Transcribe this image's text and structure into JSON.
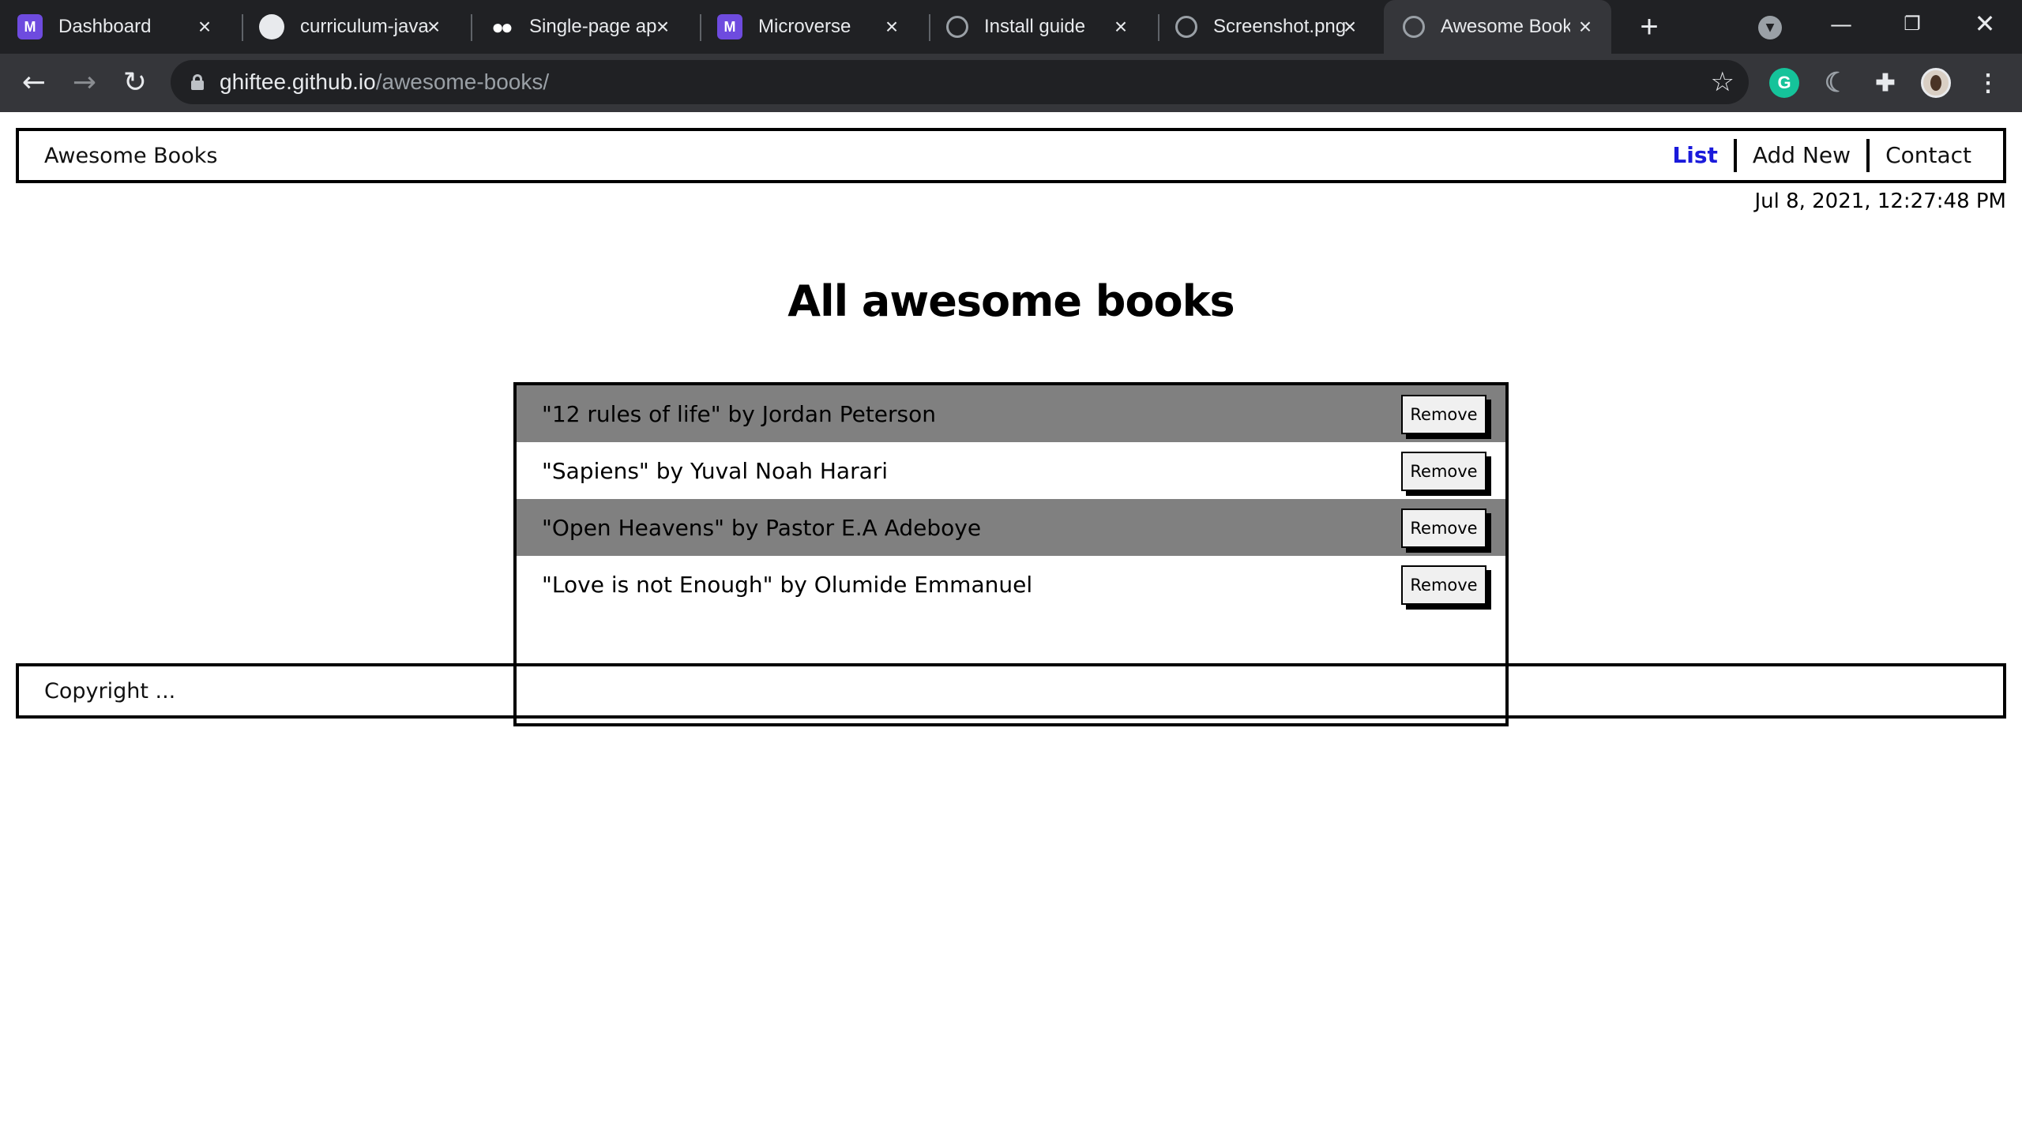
{
  "browser": {
    "tabs": [
      {
        "label": "Dashboard",
        "favicon": "microverse-icon",
        "favicon_text": "M"
      },
      {
        "label": "curriculum-java",
        "favicon": "github-icon",
        "favicon_text": "●"
      },
      {
        "label": "Single-page ap",
        "favicon": "medium-icon",
        "favicon_text": "●●"
      },
      {
        "label": "Microverse",
        "favicon": "microverse-icon",
        "favicon_text": "M"
      },
      {
        "label": "Install guide",
        "favicon": "globe-icon",
        "favicon_text": ""
      },
      {
        "label": "Screenshot.png",
        "favicon": "globe-icon",
        "favicon_text": ""
      },
      {
        "label": "Awesome Book",
        "favicon": "globe-icon",
        "favicon_text": ""
      }
    ],
    "active_tab_index": 6,
    "url_host": "ghiftee.github.io",
    "url_path": "/awesome-books/"
  },
  "header": {
    "brand": "Awesome Books",
    "nav": [
      {
        "label": "List",
        "active": true
      },
      {
        "label": "Add New",
        "active": false
      },
      {
        "label": "Contact",
        "active": false
      }
    ]
  },
  "datetime": "Jul 8, 2021, 12:27:48 PM",
  "main": {
    "heading": "All awesome books",
    "books": [
      {
        "text": "\"12 rules of life\" by Jordan Peterson",
        "button": "Remove"
      },
      {
        "text": "\"Sapiens\" by Yuval Noah Harari",
        "button": "Remove"
      },
      {
        "text": "\"Open Heavens\" by Pastor E.A Adeboye",
        "button": "Remove"
      },
      {
        "text": "\"Love is not Enough\" by Olumide Emmanuel",
        "button": "Remove"
      }
    ]
  },
  "footer": {
    "copyright": "Copyright ..."
  },
  "colors": {
    "active_nav": "#1a1adb",
    "shaded_row": "#808080",
    "chrome_dark": "#202124",
    "chrome_toolbar": "#35363a"
  }
}
